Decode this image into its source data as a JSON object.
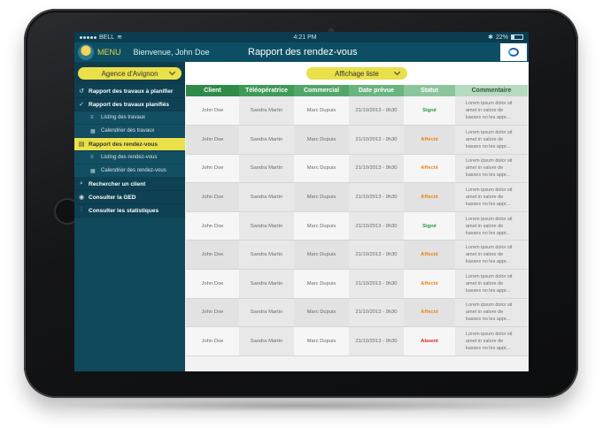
{
  "status_bar": {
    "carrier": "BELL",
    "time": "4:21 PM",
    "battery": "22%"
  },
  "header": {
    "menu_label": "MENU",
    "welcome": "Bienvenue, John Doe",
    "title": "Rapport des rendez-vous"
  },
  "sidebar": {
    "agency": "Agence d'Avignon",
    "items": [
      {
        "label": "Rapport des travaux à planifier",
        "icon": "history-icon",
        "glyph": "↺",
        "type": "main"
      },
      {
        "label": "Rapport des travaux planifiés",
        "icon": "checkmark-icon",
        "glyph": "✓",
        "type": "main"
      },
      {
        "label": "Listing des travaux",
        "icon": "list-icon",
        "glyph": "≡",
        "type": "sub"
      },
      {
        "label": "Calendrier des travaux",
        "icon": "calendar-grid-icon",
        "glyph": "▦",
        "type": "sub"
      },
      {
        "label": "Rapport des rendez-vous",
        "icon": "calendar-icon",
        "glyph": "▤",
        "type": "main",
        "active": true
      },
      {
        "label": "Listing des rendez-vous",
        "icon": "list-icon",
        "glyph": "≡",
        "type": "sub"
      },
      {
        "label": "Calendrier des rendez-vous",
        "icon": "calendar-grid-icon",
        "glyph": "▦",
        "type": "sub"
      },
      {
        "label": "Rechercher un client",
        "icon": "search-icon",
        "glyph": "⌕",
        "type": "main"
      },
      {
        "label": "Consulter la GED",
        "icon": "eye-icon",
        "glyph": "◉",
        "type": "main"
      },
      {
        "label": "Consulter les statistiques",
        "icon": "sliders-icon",
        "glyph": "⫶",
        "type": "main"
      }
    ]
  },
  "main": {
    "view_select": "Affichage liste",
    "columns": [
      "Client",
      "Téléopératrice",
      "Commercial",
      "Date prévue",
      "Statut",
      "Commentaire"
    ],
    "comment_lines": [
      "Lorem ipsum dolor sit",
      "amet in valore de",
      "kasses no les appr..."
    ],
    "rows": [
      {
        "client": "John Doe",
        "operator": "Sandra Martin",
        "sales": "Marc Dupuis",
        "date": "21/10/2013 - 9h30",
        "status": "Signé"
      },
      {
        "client": "John Doe",
        "operator": "Sandra Martin",
        "sales": "Marc Dupuis",
        "date": "21/10/2013 - 9h30",
        "status": "Affecté"
      },
      {
        "client": "John Doe",
        "operator": "Sandra Martin",
        "sales": "Marc Dupuis",
        "date": "21/10/2013 - 9h30",
        "status": "Affecté"
      },
      {
        "client": "John Doe",
        "operator": "Sandra Martin",
        "sales": "Marc Dupuis",
        "date": "21/10/2013 - 9h30",
        "status": "Affecté"
      },
      {
        "client": "John Doe",
        "operator": "Sandra Martin",
        "sales": "Marc Dupuis",
        "date": "21/10/2013 - 9h30",
        "status": "Signé"
      },
      {
        "client": "John Doe",
        "operator": "Sandra Martin",
        "sales": "Marc Dupuis",
        "date": "21/10/2013 - 9h30",
        "status": "Affecté"
      },
      {
        "client": "John Doe",
        "operator": "Sandra Martin",
        "sales": "Marc Dupuis",
        "date": "21/10/2013 - 9h30",
        "status": "Affecté"
      },
      {
        "client": "John Doe",
        "operator": "Sandra Martin",
        "sales": "Marc Dupuis",
        "date": "21/10/2013 - 9h30",
        "status": "Affecté"
      },
      {
        "client": "John Doe",
        "operator": "Sandra Martin",
        "sales": "Marc Dupuis",
        "date": "21/10/2013 - 9h30",
        "status": "Absent"
      }
    ],
    "status_colors": {
      "Signé": "#2e9a3e",
      "Affecté": "#e8861a",
      "Absent": "#d9261c"
    }
  }
}
